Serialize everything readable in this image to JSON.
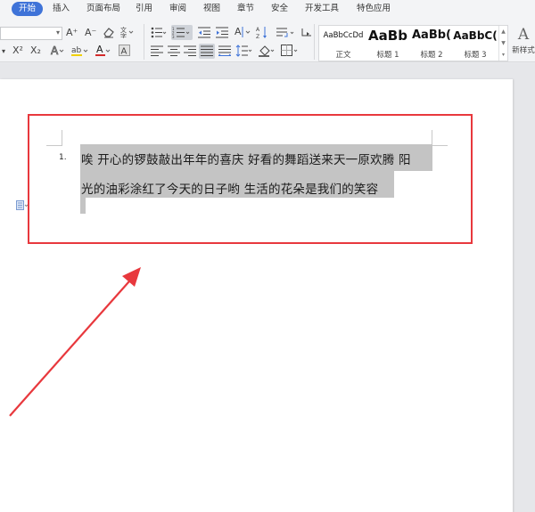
{
  "ribbon_tabs": [
    {
      "label": "开始",
      "active": true
    },
    {
      "label": "插入",
      "active": false
    },
    {
      "label": "页面布局",
      "active": false
    },
    {
      "label": "引用",
      "active": false
    },
    {
      "label": "审阅",
      "active": false
    },
    {
      "label": "视图",
      "active": false
    },
    {
      "label": "章节",
      "active": false
    },
    {
      "label": "安全",
      "active": false
    },
    {
      "label": "开发工具",
      "active": false
    },
    {
      "label": "特色应用",
      "active": false
    }
  ],
  "toolbar": {
    "font_name": "",
    "grow_font": "A⁺",
    "shrink_font": "A⁻",
    "superscript": "X²",
    "subscript": "X₂",
    "font_color_glyph": "A",
    "char_shading_glyph": "A",
    "char_border_glyph": "A"
  },
  "styles": [
    {
      "preview": "AaBbCcDd",
      "name": "正文"
    },
    {
      "preview": "AaBb",
      "name": "标题 1"
    },
    {
      "preview": "AaBb(",
      "name": "标题 2"
    },
    {
      "preview": "AaBbC(",
      "name": "标题 3"
    }
  ],
  "new_style": {
    "glyph": "A",
    "label": "新样式"
  },
  "document": {
    "list_number": "1.",
    "line1": "唉  开心的锣鼓敲出年年的喜庆  好看的舞蹈送来天一原欢腾  阳",
    "line2": "光的油彩涂红了今天的日子哟  生活的花朵是我们的笑容"
  },
  "colors": {
    "accent": "#3f73d8",
    "selection": "#c4c4c4",
    "annotation_red": "#e8383d"
  }
}
